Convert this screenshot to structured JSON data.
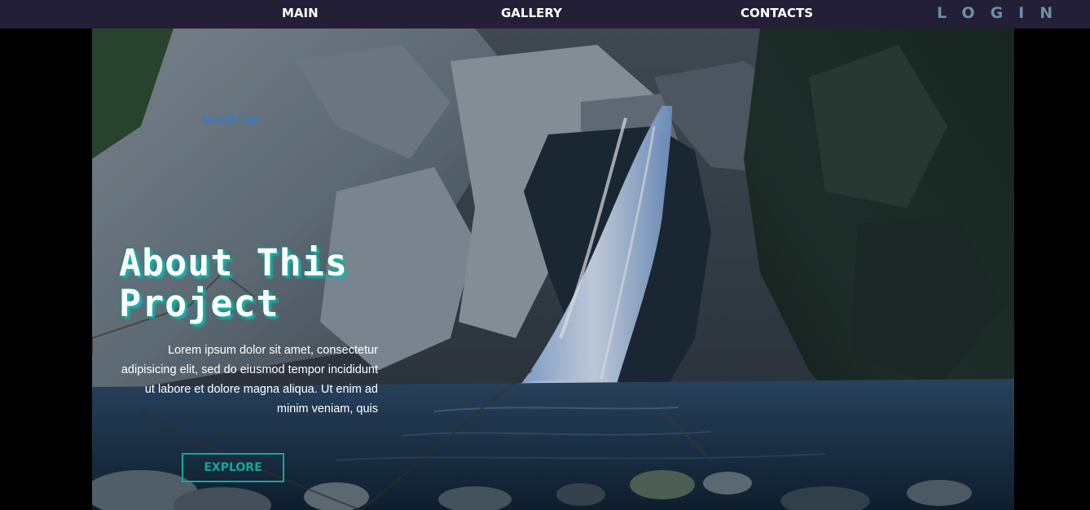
{
  "nav": {
    "main": "MAIN",
    "gallery": "GALLERY",
    "contacts": "CONTACTS",
    "login": "LOGIN"
  },
  "hero": {
    "brand_logo": "brand logo",
    "title": "About This Project",
    "text": "Lorem ipsum dolor sit amet, consectetur adipisicing elit, sed do eiusmod tempor incididunt ut labore et dolore magna aliqua. Ut enim ad minim veniam, quis",
    "explore_label": "EXPLORE",
    "background": "waterfall"
  },
  "colors": {
    "nav_bg": "#221f36",
    "accent": "#13a89e",
    "login": "#6f8fa6",
    "brand_logo": "#2a7bd6"
  }
}
